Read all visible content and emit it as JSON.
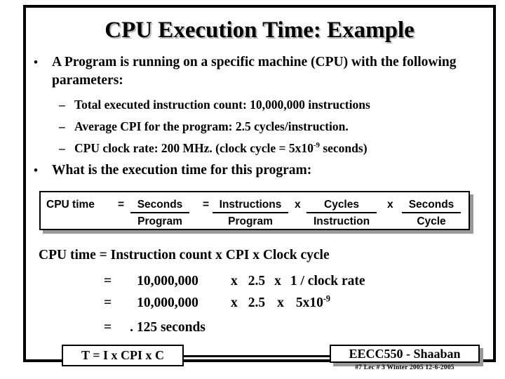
{
  "slide": {
    "title": "CPU Execution Time: Example",
    "bullets": [
      {
        "marker": "•",
        "text": "A Program is running on a specific machine (CPU) with the following parameters:",
        "sub_items": [
          {
            "marker": "–",
            "text_before": "Total executed instruction count:   10,000,000  instructions",
            "sup": "",
            "text_after": ""
          },
          {
            "marker": "–",
            "text_before": "Average CPI for the program:  2.5  cycles/instruction.",
            "sup": "",
            "text_after": ""
          },
          {
            "marker": "–",
            "text_before": "CPU clock rate:  200 MHz.  (clock cycle = 5x10",
            "sup": "-9",
            "text_after": " seconds)"
          }
        ]
      },
      {
        "marker": "•",
        "text": "What is the execution time for this program:",
        "sub_items": []
      }
    ],
    "formula_box": {
      "label": "CPU time",
      "eq1": "=",
      "fraction1": {
        "numerator": "Seconds",
        "denominator": "Program"
      },
      "eq2": "=",
      "fraction2": {
        "numerator": "Instructions",
        "denominator": "Program"
      },
      "mul1": "x",
      "fraction3": {
        "numerator": "Cycles",
        "denominator": "Instruction"
      },
      "mul2": "x",
      "fraction4": {
        "numerator": "Seconds",
        "denominator": "Cycle"
      }
    },
    "calculation": {
      "line1": "CPU time =  Instruction count  x  CPI x  Clock cycle",
      "line2_eq": "=",
      "line2_count": "10,000,000",
      "line2_mul": "x",
      "line2_cpi": "2.5",
      "line2_mul2": "x",
      "line2_cycle": "1 / clock rate",
      "line3_eq": "=",
      "line3_count": "10,000,000",
      "line3_mul": "x",
      "line3_cpi": "2.5",
      "line3_mul2": "x",
      "line3_cycle_base": "5x10",
      "line3_cycle_sup": "-9",
      "line4_eq": "=",
      "line4_result": ". 125  seconds"
    },
    "summary_box": {
      "text": "T =  I x  CPI  x C"
    },
    "footer": {
      "course": "EECC550 - Shaaban",
      "details": "#7   Lec # 3    Winter 2005   12-6-2005"
    },
    "colors": {
      "text": "#000000",
      "background": "#ffffff",
      "shadow": "#999999",
      "title_shadow": "#b8b8b8"
    }
  }
}
